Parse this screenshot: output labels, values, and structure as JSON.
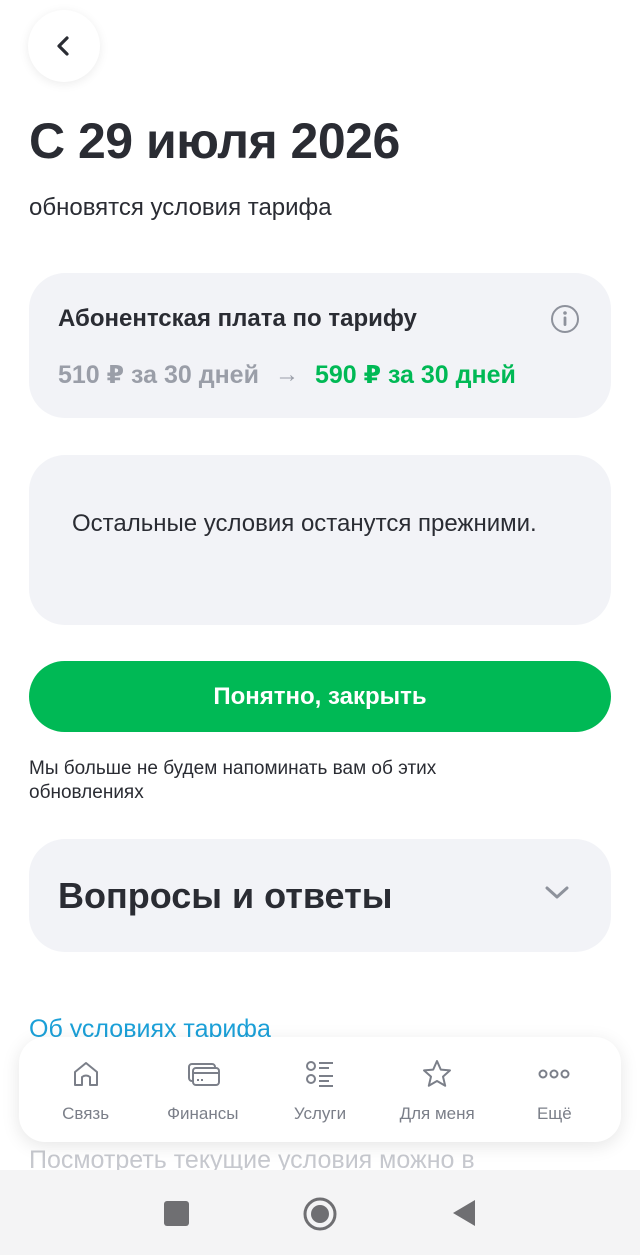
{
  "header": {
    "title": "С 29 июля 2026",
    "subtitle": "обновятся условия тарифа"
  },
  "fee_card": {
    "title": "Абонентская плата по тарифу",
    "old_price": "510 ₽ за 30 дней",
    "arrow": "→",
    "new_price": "590 ₽ за 30 дней"
  },
  "note_card": {
    "text": "Остальные условия останутся прежними."
  },
  "primary_button": {
    "label": "Понятно, закрыть"
  },
  "remind_text": "Мы больше не будем напоминать вам об этих обновлениях",
  "faq": {
    "title": "Вопросы и ответы"
  },
  "link": {
    "label": "Об условиях тарифа"
  },
  "faded_text": "Посмотреть текущие условия можно в",
  "tabbar": {
    "items": [
      {
        "label": "Связь",
        "icon": "home-icon"
      },
      {
        "label": "Финансы",
        "icon": "card-icon"
      },
      {
        "label": "Услуги",
        "icon": "list-icon"
      },
      {
        "label": "Для меня",
        "icon": "star-icon"
      },
      {
        "label": "Ещё",
        "icon": "more-icon"
      }
    ]
  },
  "colors": {
    "accent": "#00b955",
    "link": "#1ba0d8",
    "card_bg": "#f2f3f7",
    "muted": "#9a9ea8"
  }
}
